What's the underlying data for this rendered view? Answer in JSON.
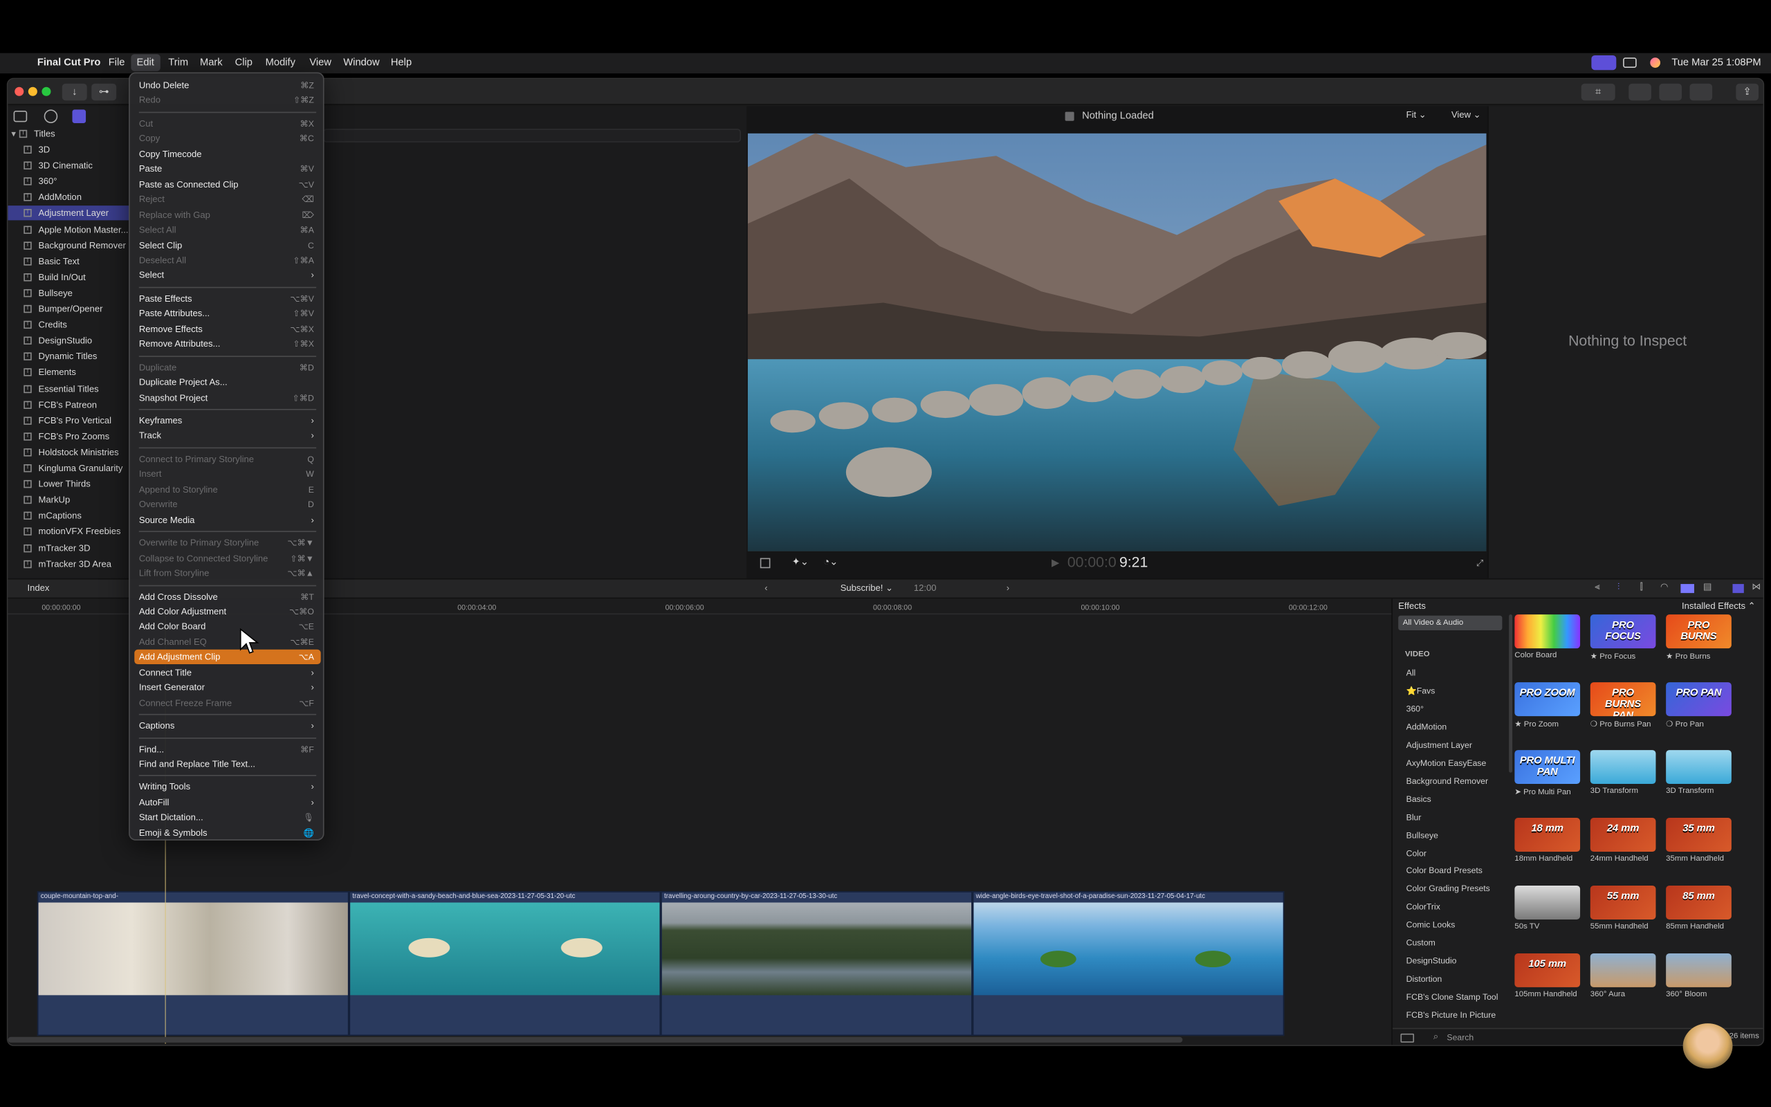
{
  "menubar": {
    "app_name": "Final Cut Pro",
    "menus": [
      "File",
      "Edit",
      "Trim",
      "Mark",
      "Clip",
      "Modify",
      "View",
      "Window",
      "Help"
    ],
    "clock": "Tue Mar 25  1:08PM"
  },
  "libraries": {
    "root": "Titles",
    "items": [
      "3D",
      "3D Cinematic",
      "360°",
      "AddMotion",
      "Adjustment Layer",
      "Apple Motion Master...",
      "Background Remover",
      "Basic Text",
      "Build In/Out",
      "Bullseye",
      "Bumper/Opener",
      "Credits",
      "DesignStudio",
      "Dynamic Titles",
      "Elements",
      "Essential Titles",
      "FCB's Patreon",
      "FCB's Pro Vertical",
      "FCB's Pro Zooms",
      "Holdstock Ministries",
      "Kingluma Granularity",
      "Lower Thirds",
      "MarkUp",
      "mCaptions",
      "motionVFX Freebies",
      "mTracker 3D",
      "mTracker 3D Area"
    ],
    "selected_index": 4
  },
  "viewer": {
    "status": "Nothing Loaded",
    "fit_label": "Fit",
    "view_label": "View",
    "timecode_dim": "00:00:0",
    "timecode": "9:21"
  },
  "inspector": {
    "message": "Nothing to Inspect"
  },
  "timeline_bar": {
    "index_label": "Index",
    "project_name": "Subscribe!",
    "duration": "12:00"
  },
  "ruler": [
    "00:00:00:00",
    "00:00:04:00",
    "00:00:06:00",
    "00:00:08:00",
    "00:00:10:00",
    "00:00:12:00"
  ],
  "clips": [
    "couple-mountain-top-and-",
    "travel-concept-with-a-sandy-beach-and-blue-sea-2023-11-27-05-31-20-utc",
    "travelling-aroung-country-by-car-2023-11-27-05-13-30-utc",
    "wide-angle-birds-eye-travel-shot-of-a-paradise-sun-2023-11-27-05-04-17-utc"
  ],
  "effects": {
    "title": "Effects",
    "scope": "Installed Effects",
    "all_label": "All Video & Audio",
    "video_header": "VIDEO",
    "categories": [
      "All",
      "⭐Favs",
      "360°",
      "AddMotion",
      "Adjustment Layer",
      "AxyMotion EasyEase",
      "Background Remover",
      "Basics",
      "Blur",
      "Bullseye",
      "Color",
      "Color Board Presets",
      "Color Grading Presets",
      "ColorTrix",
      "Comic Looks",
      "Custom",
      "DesignStudio",
      "Distortion",
      "FCB's Clone Stamp Tool",
      "FCB's Picture In Picture"
    ],
    "tiles": [
      {
        "label": "Color Board",
        "badge": ""
      },
      {
        "label": "★ Pro Focus",
        "badge": "PRO FOCUS"
      },
      {
        "label": "★ Pro Burns",
        "badge": "PRO BURNS"
      },
      {
        "label": "★ Pro Zoom",
        "badge": "PRO ZOOM"
      },
      {
        "label": "❍ Pro Burns Pan",
        "badge": "PRO BURNS PAN"
      },
      {
        "label": "❍ Pro Pan",
        "badge": "PRO PAN"
      },
      {
        "label": "➤ Pro Multi Pan",
        "badge": "PRO MULTI PAN"
      },
      {
        "label": "3D Transform",
        "badge": ""
      },
      {
        "label": "3D Transform",
        "badge": ""
      },
      {
        "label": "18mm Handheld",
        "badge": "18 mm"
      },
      {
        "label": "24mm Handheld",
        "badge": "24 mm"
      },
      {
        "label": "35mm Handheld",
        "badge": "35 mm"
      },
      {
        "label": "50s TV",
        "badge": ""
      },
      {
        "label": "55mm Handheld",
        "badge": "55 mm"
      },
      {
        "label": "85mm Handheld",
        "badge": "85 mm"
      },
      {
        "label": "105mm Handheld",
        "badge": "105 mm"
      },
      {
        "label": "360° Aura",
        "badge": ""
      },
      {
        "label": "360° Bloom",
        "badge": ""
      }
    ],
    "search_placeholder": "Search",
    "count": "26 items"
  },
  "edit_menu": {
    "rows": [
      {
        "label": "Undo Delete",
        "shortcut": "⌘Z",
        "enabled": true
      },
      {
        "label": "Redo",
        "shortcut": "⇧⌘Z",
        "enabled": false
      },
      {
        "sep": true
      },
      {
        "label": "Cut",
        "shortcut": "⌘X",
        "enabled": false
      },
      {
        "label": "Copy",
        "shortcut": "⌘C",
        "enabled": false
      },
      {
        "label": "Copy Timecode",
        "shortcut": "",
        "enabled": true
      },
      {
        "label": "Paste",
        "shortcut": "⌘V",
        "enabled": true
      },
      {
        "label": "Paste as Connected Clip",
        "shortcut": "⌥V",
        "enabled": true
      },
      {
        "label": "Reject",
        "shortcut": "⌫",
        "enabled": false
      },
      {
        "label": "Replace with Gap",
        "shortcut": "⌦",
        "enabled": false
      },
      {
        "label": "Select All",
        "shortcut": "⌘A",
        "enabled": false
      },
      {
        "label": "Select Clip",
        "shortcut": "C",
        "enabled": true
      },
      {
        "label": "Deselect All",
        "shortcut": "⇧⌘A",
        "enabled": false
      },
      {
        "label": "Select",
        "submenu": true,
        "enabled": true
      },
      {
        "sep": true
      },
      {
        "label": "Paste Effects",
        "shortcut": "⌥⌘V",
        "enabled": true
      },
      {
        "label": "Paste Attributes...",
        "shortcut": "⇧⌘V",
        "enabled": true
      },
      {
        "label": "Remove Effects",
        "shortcut": "⌥⌘X",
        "enabled": true
      },
      {
        "label": "Remove Attributes...",
        "shortcut": "⇧⌘X",
        "enabled": true
      },
      {
        "sep": true
      },
      {
        "label": "Duplicate",
        "shortcut": "⌘D",
        "enabled": false
      },
      {
        "label": "Duplicate Project As...",
        "shortcut": "",
        "enabled": true
      },
      {
        "label": "Snapshot Project",
        "shortcut": "⇧⌘D",
        "enabled": true
      },
      {
        "sep": true
      },
      {
        "label": "Keyframes",
        "submenu": true,
        "enabled": true
      },
      {
        "label": "Track",
        "submenu": true,
        "enabled": true
      },
      {
        "sep": true
      },
      {
        "label": "Connect to Primary Storyline",
        "shortcut": "Q",
        "enabled": false
      },
      {
        "label": "Insert",
        "shortcut": "W",
        "enabled": false
      },
      {
        "label": "Append to Storyline",
        "shortcut": "E",
        "enabled": false
      },
      {
        "label": "Overwrite",
        "shortcut": "D",
        "enabled": false
      },
      {
        "label": "Source Media",
        "submenu": true,
        "enabled": true
      },
      {
        "sep": true
      },
      {
        "label": "Overwrite to Primary Storyline",
        "shortcut": "⌥⌘▼",
        "enabled": false
      },
      {
        "label": "Collapse to Connected Storyline",
        "shortcut": "⇧⌘▼",
        "enabled": false
      },
      {
        "label": "Lift from Storyline",
        "shortcut": "⌥⌘▲",
        "enabled": false
      },
      {
        "sep": true
      },
      {
        "label": "Add Cross Dissolve",
        "shortcut": "⌘T",
        "enabled": true
      },
      {
        "label": "Add Color Adjustment",
        "shortcut": "⌥⌘O",
        "enabled": true
      },
      {
        "label": "Add Color Board",
        "shortcut": "⌥E",
        "enabled": true
      },
      {
        "label": "Add Channel EQ",
        "shortcut": "⌥⌘E",
        "enabled": false
      },
      {
        "label": "Add Adjustment Clip",
        "shortcut": "⌥A",
        "enabled": true,
        "highlight": true
      },
      {
        "label": "Connect Title",
        "submenu": true,
        "enabled": true
      },
      {
        "label": "Insert Generator",
        "submenu": true,
        "enabled": true
      },
      {
        "label": "Connect Freeze Frame",
        "shortcut": "⌥F",
        "enabled": false
      },
      {
        "sep": true
      },
      {
        "label": "Captions",
        "submenu": true,
        "enabled": true
      },
      {
        "sep": true
      },
      {
        "label": "Find...",
        "shortcut": "⌘F",
        "enabled": true
      },
      {
        "label": "Find and Replace Title Text...",
        "shortcut": "",
        "enabled": true
      },
      {
        "sep": true
      },
      {
        "label": "Writing Tools",
        "submenu": true,
        "enabled": true
      },
      {
        "label": "AutoFill",
        "submenu": true,
        "enabled": true
      },
      {
        "label": "Start Dictation...",
        "shortcut": "🎙",
        "enabled": true
      },
      {
        "label": "Emoji & Symbols",
        "shortcut": "🌐",
        "enabled": true
      }
    ]
  },
  "colors": {
    "menu_highlight": "#d5731d",
    "selection": "#3a3d8c",
    "clip_blue": "#2a3a5e"
  }
}
